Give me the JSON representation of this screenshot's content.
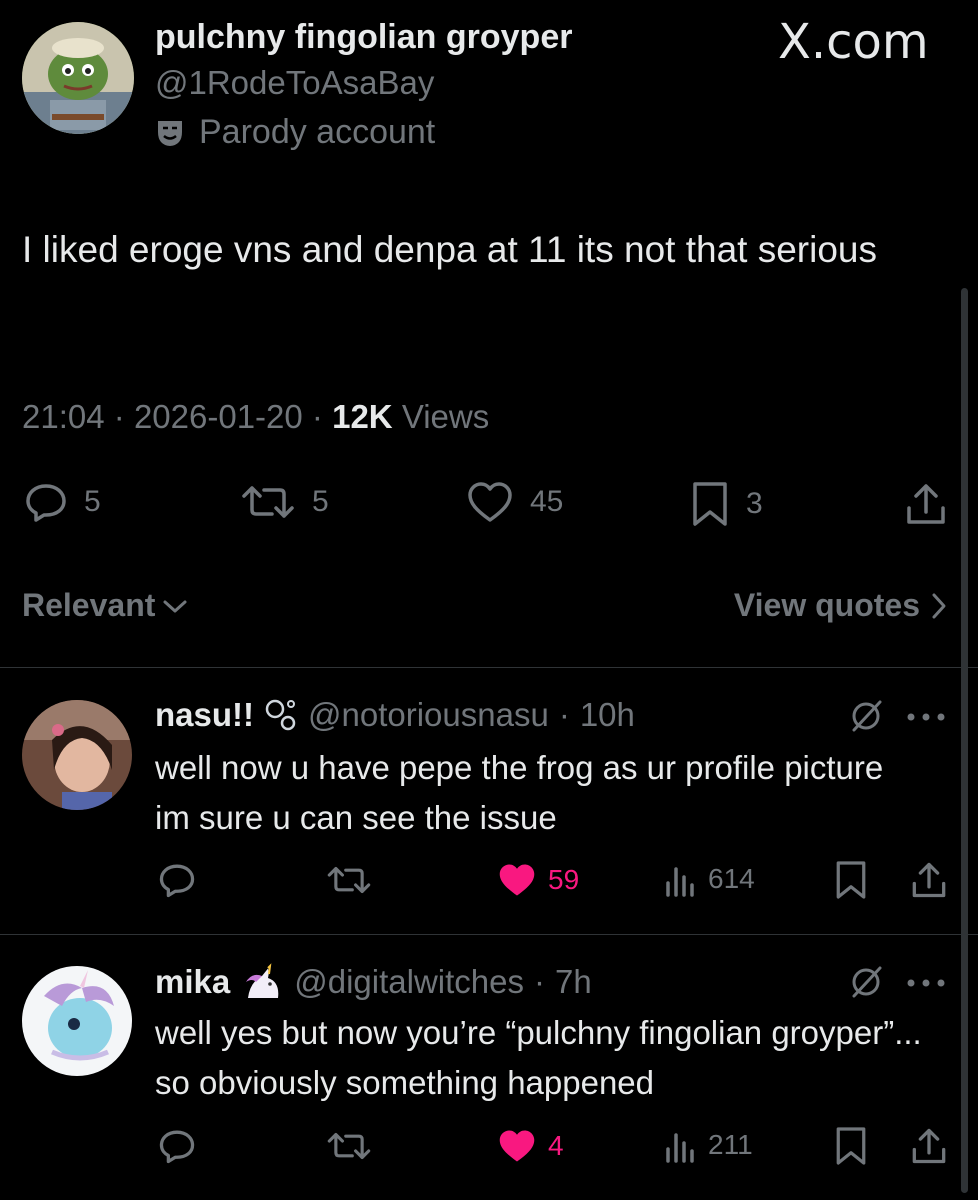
{
  "watermark": "X.com",
  "main_tweet": {
    "display_name": "pulchny fingolian groyper",
    "handle": "@1RodeToAsaBay",
    "parody_label": "Parody account",
    "text": "I liked eroge vns and denpa at 11 its not that serious",
    "time": "21:04",
    "date": "2026-01-20",
    "views_count": "12K",
    "views_label": "Views",
    "separator": "·",
    "replies": "5",
    "reposts": "5",
    "likes": "45",
    "bookmarks": "3"
  },
  "sort": {
    "label": "Relevant"
  },
  "quotes_link": {
    "label": "View quotes"
  },
  "replies": [
    {
      "display_name": "nasu!!",
      "handle": "@notoriousnasu",
      "time": "10h",
      "text": "well now u have pepe the frog as ur profile picture im sure u can see the issue",
      "likes": "59",
      "views": "614"
    },
    {
      "display_name": "mika",
      "handle": "@digitalwitches",
      "time": "7h",
      "text": "well yes but now you’re “pulchny fingolian groyper”... so obviously something happened",
      "likes": "4",
      "views": "211"
    }
  ],
  "colors": {
    "background": "#000000",
    "text": "#e7e9ea",
    "muted": "#71767b",
    "like": "#f91880",
    "divider": "#2f3336"
  }
}
